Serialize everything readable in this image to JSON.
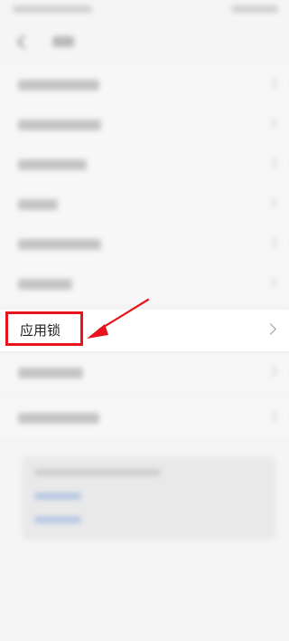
{
  "settings_list": {
    "app_lock_label": "应用锁"
  },
  "colors": {
    "highlight": "#e8141b",
    "background": "#f5f5f5"
  },
  "icons": {
    "back": "back-arrow-icon",
    "chevron": "chevron-right-icon",
    "pointer": "arrow-annotation-icon"
  }
}
